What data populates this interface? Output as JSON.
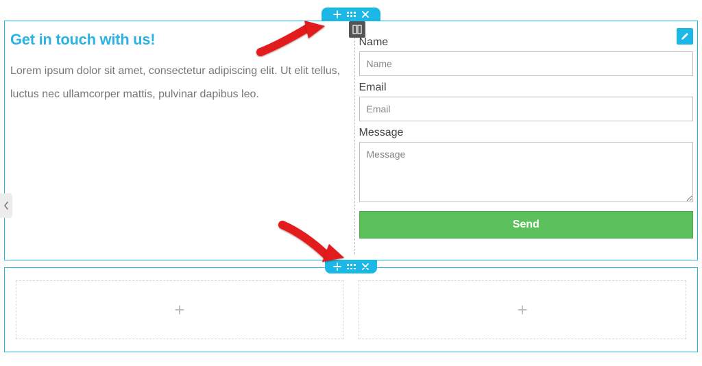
{
  "section1": {
    "heading": "Get in touch with us!",
    "paragraph": "Lorem ipsum dolor sit amet, consectetur adipiscing elit. Ut elit tellus, luctus nec ullamcorper mattis, pulvinar dapibus leo.",
    "form": {
      "name": {
        "label": "Name",
        "placeholder": "Name"
      },
      "email": {
        "label": "Email",
        "placeholder": "Email"
      },
      "message": {
        "label": "Message",
        "placeholder": "Message"
      },
      "submit_label": "Send"
    }
  },
  "colors": {
    "accent": "#1bb7e5",
    "submit": "#5cc05c"
  }
}
